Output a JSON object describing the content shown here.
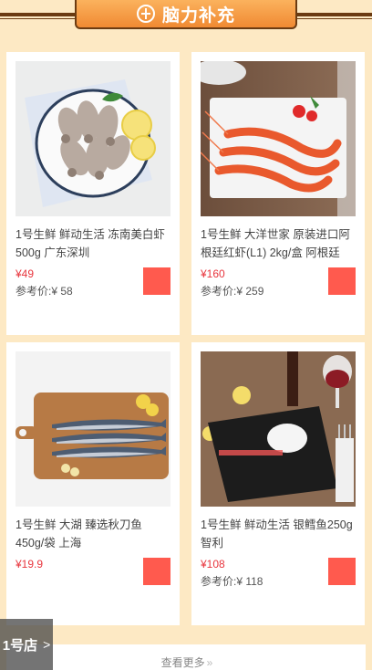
{
  "banner": {
    "title": "脑力补充",
    "icon": "brain-icon"
  },
  "products": [
    {
      "title": "1号生鲜 鲜动生活 冻南美白虾500g 广东深圳",
      "price": "¥49",
      "ref": "参考价:¥ 58"
    },
    {
      "title": "1号生鲜 大洋世家 原装进口阿根廷红虾(L1) 2kg/盒 阿根廷",
      "price": "¥160",
      "ref": "参考价:¥ 259"
    },
    {
      "title": "1号生鲜 大湖 臻选秋刀鱼 450g/袋 上海",
      "price": "¥19.9",
      "ref": ""
    },
    {
      "title": "1号生鲜 鲜动生活 银鳕鱼250g 智利",
      "price": "¥108",
      "ref": "参考价:¥ 118"
    }
  ],
  "more": {
    "label": "查看更多",
    "arrows": "»"
  },
  "float_logo": {
    "label": "1号店",
    "chevron": ">"
  },
  "colors": {
    "accent": "#ff5a4e",
    "price": "#e8353d",
    "background": "#fde9c4",
    "banner": "#f08a33"
  }
}
